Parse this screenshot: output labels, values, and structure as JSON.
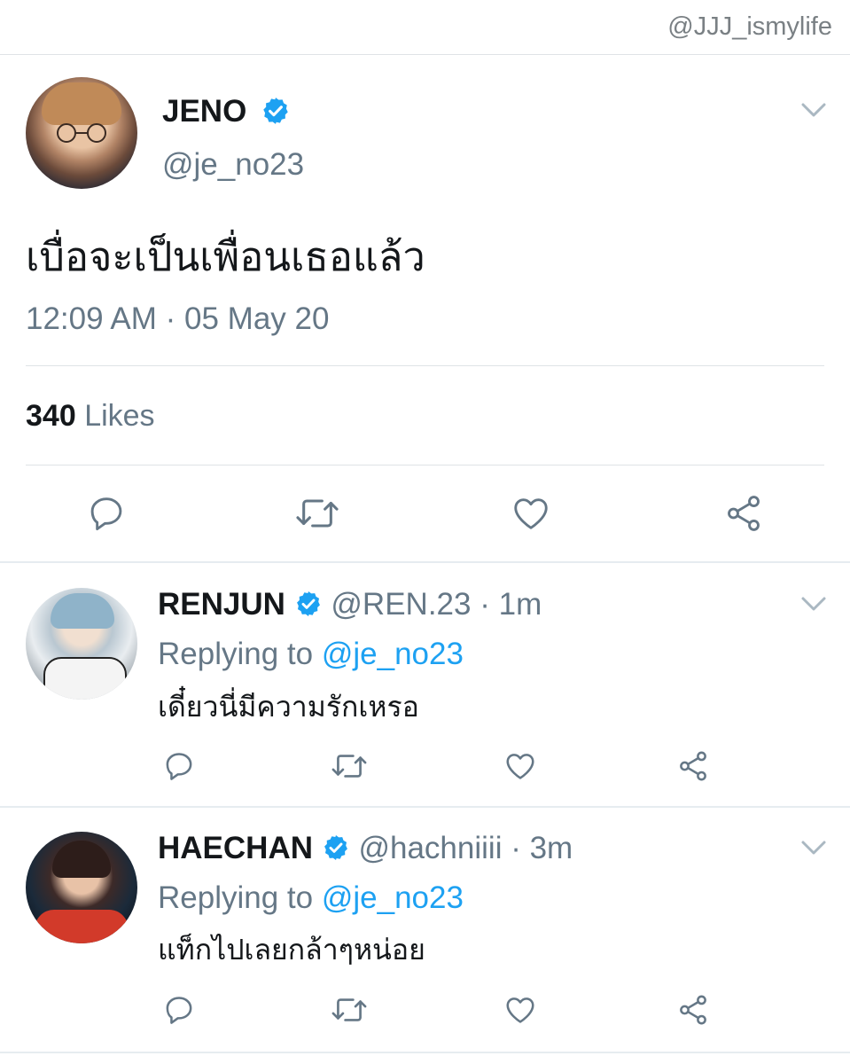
{
  "watermark": "@JJJ_ismylife",
  "main_tweet": {
    "name": "JENO",
    "handle": "@je_no23",
    "text": "เบื่อจะเป็นเพื่อนเธอแล้ว",
    "time": "12:09 AM",
    "date": "05 May 20",
    "likes_count": "340",
    "likes_label": "Likes"
  },
  "replies": [
    {
      "name": "RENJUN",
      "handle": "@REN.23",
      "time": "1m",
      "replying_label": "Replying to",
      "replying_to": "@je_no23",
      "text": "เดี๋ยวนี่มีความรักเหรอ"
    },
    {
      "name": "HAECHAN",
      "handle": "@hachniiii",
      "time": "3m",
      "replying_label": "Replying to",
      "replying_to": "@je_no23",
      "text": "แท็กไปเลยกล้าๆหน่อย"
    }
  ],
  "colors": {
    "verified": "#1da1f2",
    "mention": "#1da1f2",
    "secondary_text": "#657786",
    "icon": "#657786"
  },
  "icons": [
    "verified-icon",
    "chevron-down-icon",
    "reply-icon",
    "retweet-icon",
    "like-icon",
    "share-icon"
  ]
}
